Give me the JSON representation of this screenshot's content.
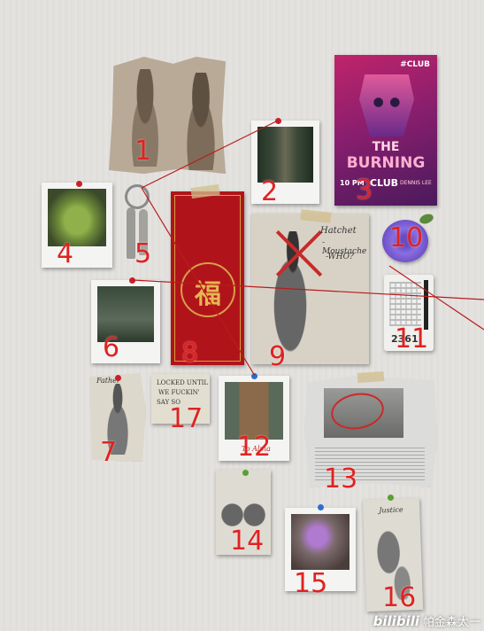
{
  "poster": {
    "tag": "#CLUB",
    "title1": "THE",
    "title2": "BURNING",
    "sub": "CLUB",
    "date": "10 PM",
    "artist": "DENNIS LEE"
  },
  "envelope": {
    "character": "福"
  },
  "sketch_notes": {
    "line1": "Hatchet",
    "line2": "-Moustache",
    "line3": "-WHO?"
  },
  "note17": {
    "line1": "LOCKED UNTIL",
    "line2": "WE FUCKIN'",
    "line3": "SAY SO"
  },
  "polaroid12_caption": "To Alma",
  "sketch16_label": "Justice",
  "sketch7_label": "Father",
  "card11_text": "2361",
  "numbers": [
    "1",
    "2",
    "3",
    "4",
    "5",
    "6",
    "7",
    "8",
    "9",
    "10",
    "11",
    "12",
    "13",
    "14",
    "15",
    "16",
    "17"
  ],
  "watermark": {
    "logo": "bilibili",
    "name": "帕金森太一"
  },
  "colors": {
    "pin_red": "#c8202a",
    "pin_blue": "#2b6fd0",
    "pin_green": "#5aa030",
    "string": "#b81c1c",
    "number": "#e02222",
    "envelope": "#b0141a"
  }
}
